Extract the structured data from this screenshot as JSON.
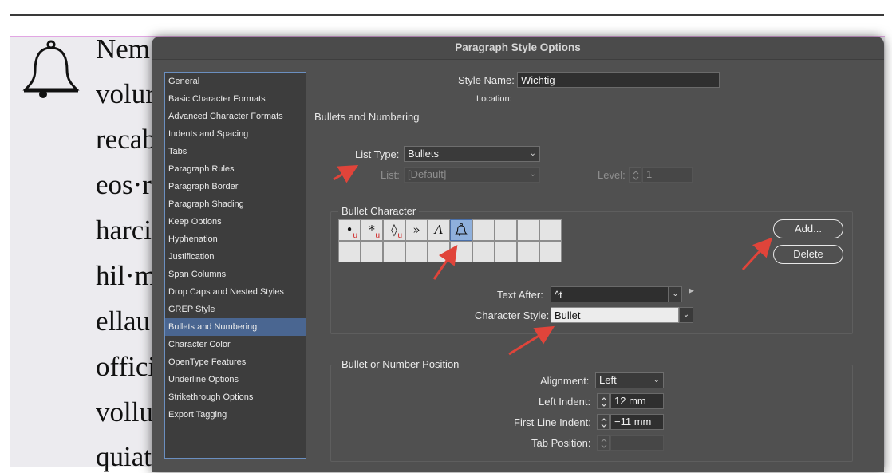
{
  "background_doc": {
    "lines": [
      "Nem",
      "volur",
      "recab",
      "eos·r",
      "harci",
      "hil·m",
      "ellau",
      "offici",
      "vollu",
      "quiat"
    ]
  },
  "dialog": {
    "title": "Paragraph Style Options",
    "sidebar_items": [
      "General",
      "Basic Character Formats",
      "Advanced Character Formats",
      "Indents and Spacing",
      "Tabs",
      "Paragraph Rules",
      "Paragraph Border",
      "Paragraph Shading",
      "Keep Options",
      "Hyphenation",
      "Justification",
      "Span Columns",
      "Drop Caps and Nested Styles",
      "GREP Style",
      "Bullets and Numbering",
      "Character Color",
      "OpenType Features",
      "Underline Options",
      "Strikethrough Options",
      "Export Tagging"
    ],
    "active_sidebar_item": "Bullets and Numbering",
    "style_name_label": "Style Name:",
    "style_name_value": "Wichtig",
    "location_label": "Location:",
    "section_heading": "Bullets and Numbering",
    "list_type_label": "List Type:",
    "list_type_value": "Bullets",
    "list_label": "List:",
    "list_value": "[Default]",
    "level_label": "Level:",
    "level_value": "1",
    "bullet_character": {
      "group_title": "Bullet Character",
      "glyphs": [
        "•",
        "*",
        "◊",
        "»",
        "A",
        "bell",
        "",
        "",
        "",
        ""
      ],
      "glyph_marks": [
        "u",
        "u",
        "u",
        "",
        "",
        "",
        "",
        "",
        "",
        ""
      ],
      "selected_index": 5,
      "add_button": "Add...",
      "delete_button": "Delete",
      "text_after_label": "Text After:",
      "text_after_value": "^t",
      "character_style_label": "Character Style:",
      "character_style_value": "Bullet"
    },
    "position": {
      "group_title": "Bullet or Number Position",
      "alignment_label": "Alignment:",
      "alignment_value": "Left",
      "left_indent_label": "Left Indent:",
      "left_indent_value": "12 mm",
      "first_line_indent_label": "First Line Indent:",
      "first_line_indent_value": "−11 mm",
      "tab_position_label": "Tab Position:",
      "tab_position_value": ""
    }
  },
  "colors": {
    "dialog_bg": "#505050",
    "selection": "#4a6691",
    "annotation_arrow": "#e0443a"
  }
}
